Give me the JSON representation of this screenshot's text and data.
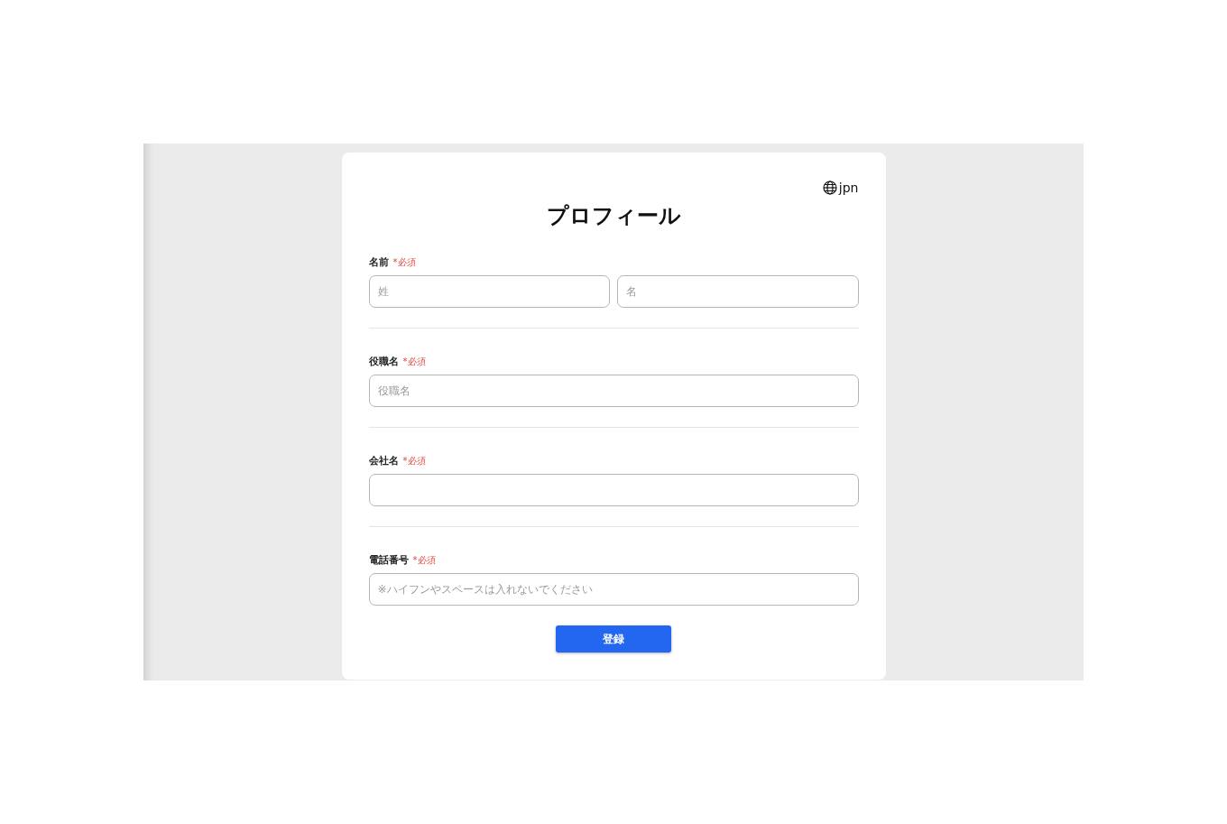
{
  "language": {
    "label": "jpn"
  },
  "title": "プロフィール",
  "fields": [
    {
      "label": "名前",
      "required_note": "*必須",
      "inputs": [
        {
          "kind": "text",
          "placeholder": "姓"
        },
        {
          "kind": "text",
          "placeholder": "名"
        }
      ]
    },
    {
      "label": "役職名",
      "required_note": "*必須",
      "inputs": [
        {
          "kind": "text",
          "placeholder": "役職名"
        }
      ]
    },
    {
      "label": "会社名",
      "required_note": "*必須",
      "inputs": [
        {
          "kind": "text"
        }
      ]
    },
    {
      "label": "電話番号",
      "required_note": "*必須",
      "inputs": [
        {
          "kind": "text",
          "placeholder": "※ハイフンやスペースは入れないでください"
        }
      ]
    }
  ],
  "submit": {
    "label": "登録"
  }
}
